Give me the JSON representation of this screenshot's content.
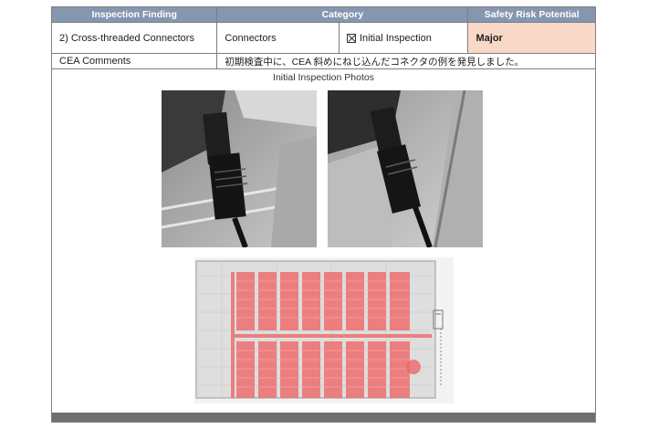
{
  "table": {
    "headers": {
      "finding": "Inspection Finding",
      "category": "Category",
      "risk": "Safety Risk Potential"
    },
    "row": {
      "finding": "2) Cross-threaded Connectors",
      "category": "Connectors",
      "inspection": "Initial Inspection",
      "risk": "Major"
    },
    "comments_label": "CEA Comments",
    "comments_text": "初期検査中に、CEA 斜めにねじ込んだコネクタの例を発見しました。"
  },
  "photos_title": "Initial Inspection Photos",
  "colors": {
    "header_bg": "#8596b0",
    "major_bg": "#f9d8c8",
    "panel_red": "#ee6666"
  }
}
